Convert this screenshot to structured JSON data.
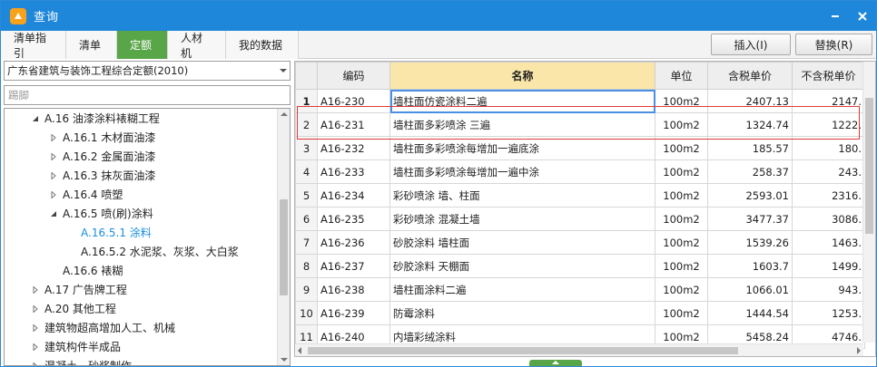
{
  "window": {
    "title": "查询"
  },
  "tabs": [
    {
      "label": "清单指引",
      "active": false
    },
    {
      "label": "清单",
      "active": false
    },
    {
      "label": "定额",
      "active": true
    },
    {
      "label": "人材机",
      "active": false
    },
    {
      "label": "我的数据",
      "active": false
    }
  ],
  "toolbar": {
    "insert_label": "插入(I)",
    "replace_label": "替换(R)"
  },
  "left_panel": {
    "quota_library": "广东省建筑与装饰工程综合定额(2010)",
    "search_value": "踢脚",
    "tree": [
      {
        "label": "A.16 油漆涂料裱糊工程",
        "level": 1,
        "expanded": true
      },
      {
        "label": "A.16.1 木材面油漆",
        "level": 2,
        "expanded": false
      },
      {
        "label": "A.16.2 金属面油漆",
        "level": 2,
        "expanded": false
      },
      {
        "label": "A.16.3 抹灰面油漆",
        "level": 2,
        "expanded": false
      },
      {
        "label": "A.16.4 喷塑",
        "level": 2,
        "expanded": false
      },
      {
        "label": "A.16.5 喷(刷)涂料",
        "level": 2,
        "expanded": true
      },
      {
        "label": "A.16.5.1 涂料",
        "level": 3,
        "leaf": true,
        "selected": true
      },
      {
        "label": "A.16.5.2 水泥浆、灰浆、大白浆",
        "level": 3,
        "leaf": true
      },
      {
        "label": "A.16.6 裱糊",
        "level": 2,
        "leaf": true
      },
      {
        "label": "A.17 广告牌工程",
        "level": 1,
        "expanded": false
      },
      {
        "label": "A.20 其他工程",
        "level": 1,
        "expanded": false
      },
      {
        "label": "建筑物超高增加人工、机械",
        "level": 1,
        "expanded": false
      },
      {
        "label": "建筑构件半成品",
        "level": 1,
        "expanded": false
      },
      {
        "label": "混凝土、砂浆制作",
        "level": 1,
        "expanded": false
      }
    ]
  },
  "grid": {
    "columns": [
      "",
      "编码",
      "名称",
      "单位",
      "含税单价",
      "不含税单价"
    ],
    "rows": [
      {
        "no": "1",
        "code": "A16-230",
        "name": "墙柱面仿瓷涂料二遍",
        "unit": "100m2",
        "tax_price": "2407.13",
        "notax_price": "2147."
      },
      {
        "no": "2",
        "code": "A16-231",
        "name": "墙柱面多彩喷涂 三遍",
        "unit": "100m2",
        "tax_price": "1324.74",
        "notax_price": "1222."
      },
      {
        "no": "3",
        "code": "A16-232",
        "name": "墙柱面多彩喷涂每增加一遍底涂",
        "unit": "100m2",
        "tax_price": "185.57",
        "notax_price": "180."
      },
      {
        "no": "4",
        "code": "A16-233",
        "name": "墙柱面多彩喷涂每增加一遍中涂",
        "unit": "100m2",
        "tax_price": "258.37",
        "notax_price": "243."
      },
      {
        "no": "5",
        "code": "A16-234",
        "name": "彩砂喷涂 墙、柱面",
        "unit": "100m2",
        "tax_price": "2593.01",
        "notax_price": "2316."
      },
      {
        "no": "6",
        "code": "A16-235",
        "name": "彩砂喷涂 混凝土墙",
        "unit": "100m2",
        "tax_price": "3477.37",
        "notax_price": "3086."
      },
      {
        "no": "7",
        "code": "A16-236",
        "name": "砂胶涂料 墙柱面",
        "unit": "100m2",
        "tax_price": "1539.26",
        "notax_price": "1463."
      },
      {
        "no": "8",
        "code": "A16-237",
        "name": "砂胶涂料 天棚面",
        "unit": "100m2",
        "tax_price": "1603.7",
        "notax_price": "1499."
      },
      {
        "no": "9",
        "code": "A16-238",
        "name": "墙柱面涂料二遍",
        "unit": "100m2",
        "tax_price": "1066.01",
        "notax_price": "943."
      },
      {
        "no": "10",
        "code": "A16-239",
        "name": "防霉涂料",
        "unit": "100m2",
        "tax_price": "1444.54",
        "notax_price": "1253."
      },
      {
        "no": "11",
        "code": "A16-240",
        "name": "内墙彩绒涂料",
        "unit": "100m2",
        "tax_price": "5458.24",
        "notax_price": "4746."
      }
    ]
  },
  "icons": {
    "app": "app-logo-icon",
    "minimize": "minimize-icon",
    "close": "close-icon"
  },
  "colors": {
    "titlebar": "#1f87da",
    "active_tab": "#58a648",
    "sorted_header": "#f9e6a8",
    "selected_tree": "#1a8fe0",
    "highlight_box": "#e03a3a"
  }
}
